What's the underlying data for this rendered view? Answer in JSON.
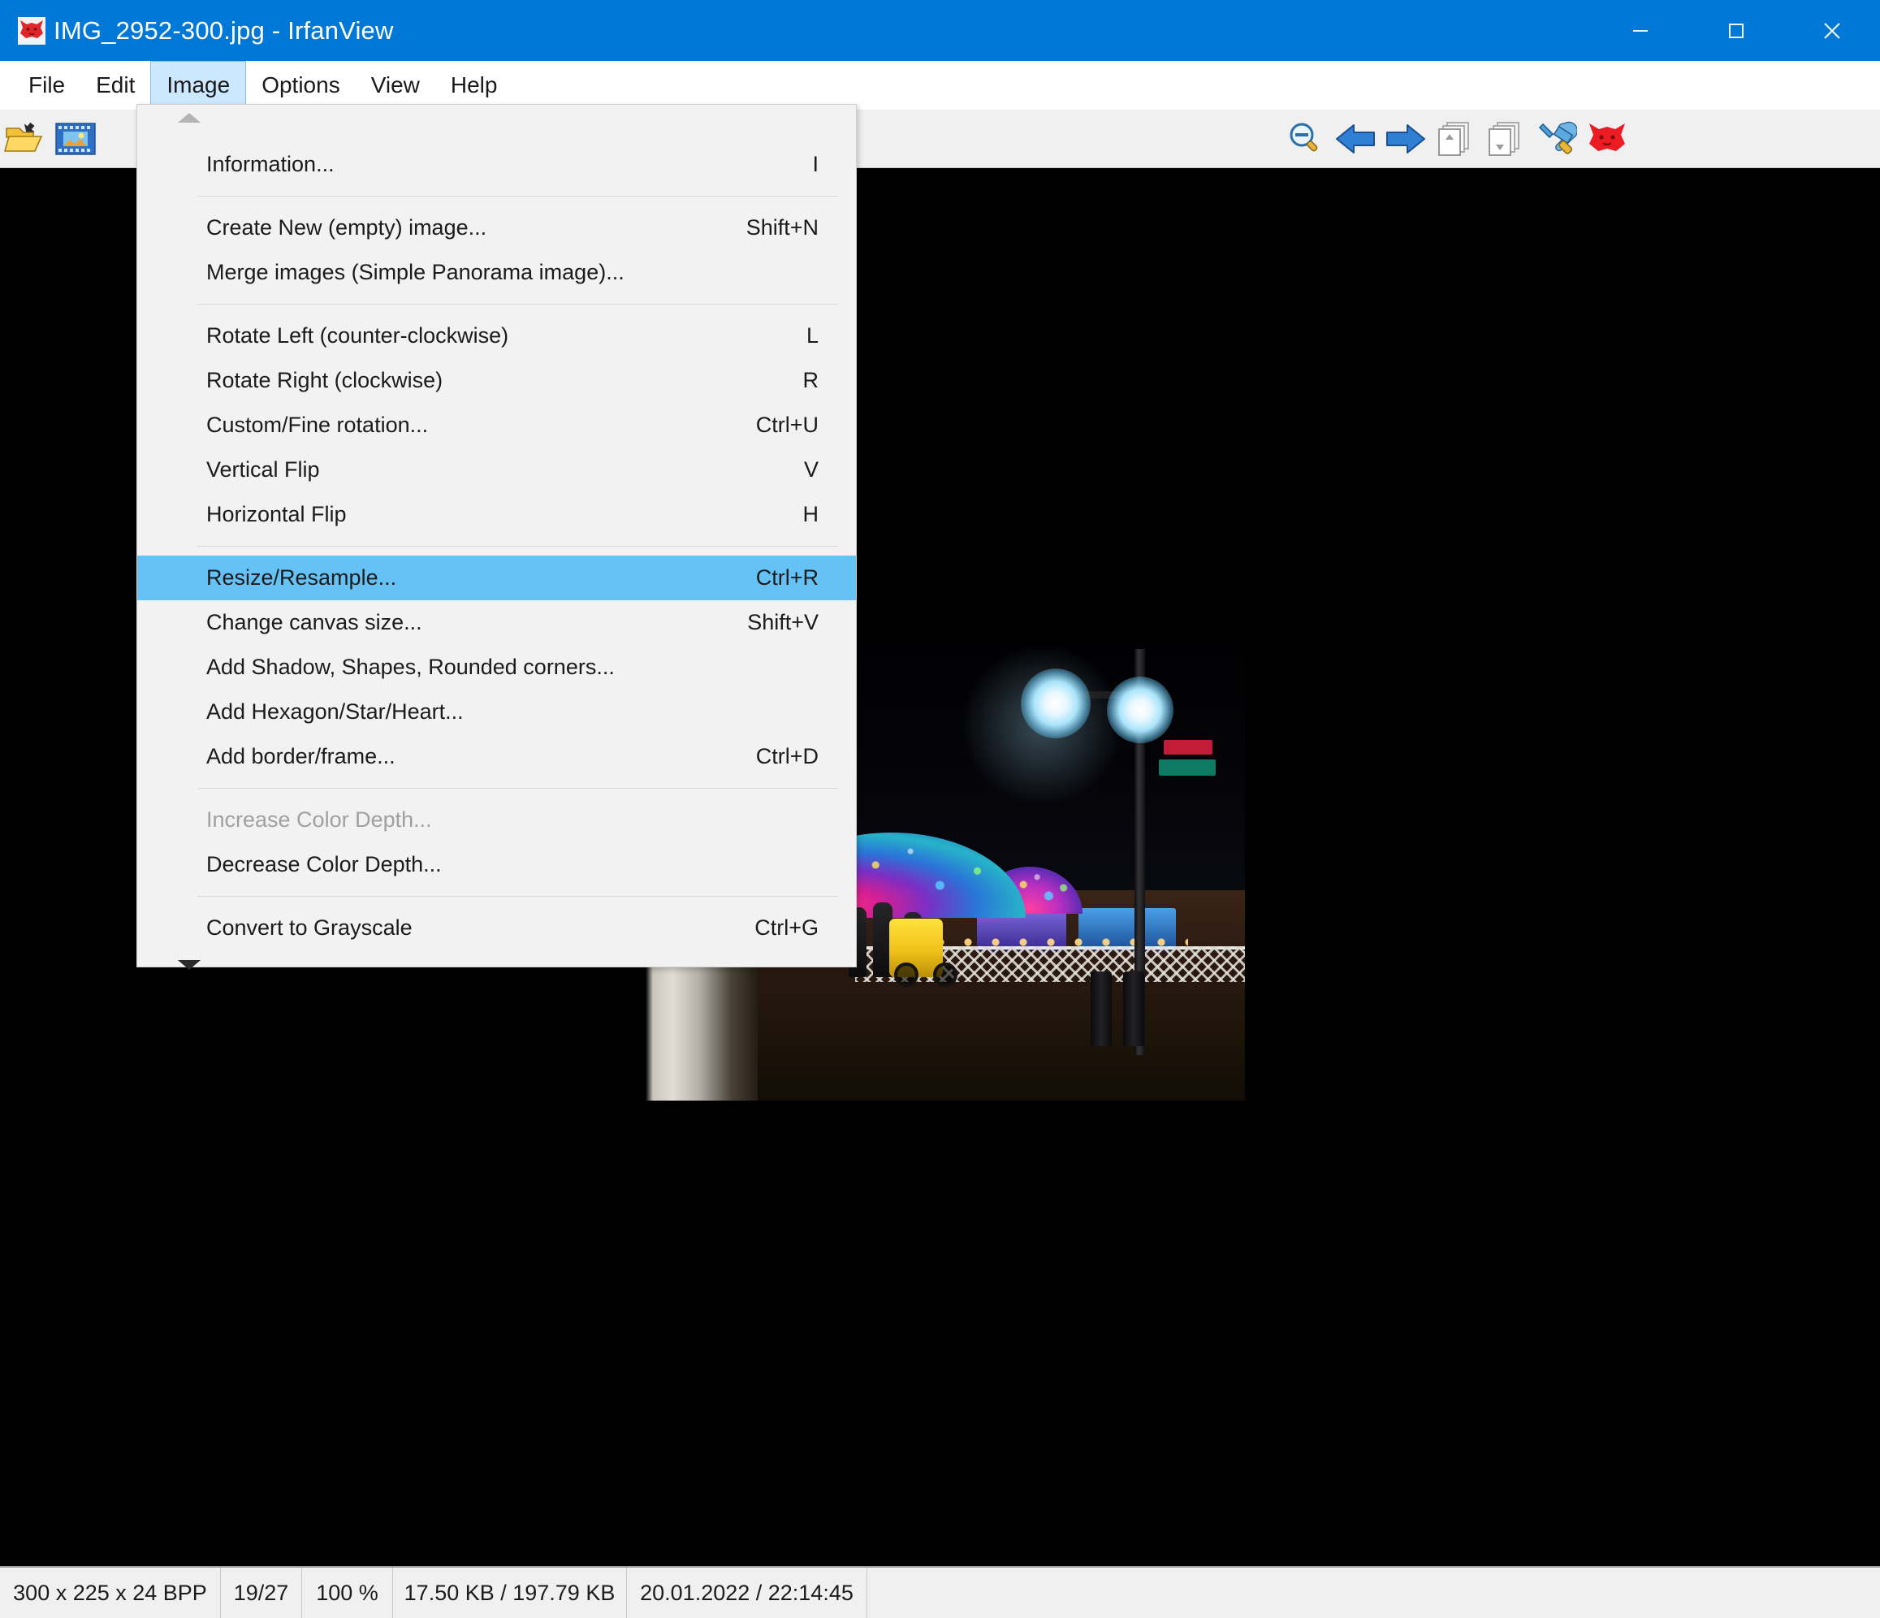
{
  "window": {
    "title": "IMG_2952-300.jpg - IrfanView",
    "app_icon": "irfanview-cat-icon",
    "controls": {
      "minimize": "minimize-icon",
      "maximize": "maximize-icon",
      "close": "close-icon"
    },
    "accent_color": "#0078d7"
  },
  "menubar": {
    "items": [
      {
        "label": "File",
        "active": false
      },
      {
        "label": "Edit",
        "active": false
      },
      {
        "label": "Image",
        "active": true
      },
      {
        "label": "Options",
        "active": false
      },
      {
        "label": "View",
        "active": false
      },
      {
        "label": "Help",
        "active": false
      }
    ]
  },
  "toolbar": {
    "buttons": [
      {
        "icon": "open-folder-icon",
        "enabled": true
      },
      {
        "icon": "thumbnails-icon",
        "enabled": true
      },
      {
        "icon": "zoom-out-icon",
        "enabled": true
      },
      {
        "icon": "previous-arrow-icon",
        "enabled": true
      },
      {
        "icon": "next-arrow-icon",
        "enabled": true
      },
      {
        "icon": "batch-up-icon",
        "enabled": false
      },
      {
        "icon": "batch-down-icon",
        "enabled": false
      },
      {
        "icon": "tools-settings-icon",
        "enabled": true
      },
      {
        "icon": "irfanview-cat-icon",
        "enabled": true
      }
    ]
  },
  "image_menu": {
    "scroll_up_icon": "scroll-up-arrow-icon",
    "scroll_down_icon": "scroll-down-arrow-icon",
    "highlight_color": "#66c2f5",
    "items": [
      {
        "label": "Information...",
        "accel": "I",
        "selected": false,
        "disabled": false,
        "sep_after": true
      },
      {
        "label": "Create New (empty) image...",
        "accel": "Shift+N",
        "selected": false,
        "disabled": false,
        "sep_after": false
      },
      {
        "label": "Merge images (Simple Panorama image)...",
        "accel": "",
        "selected": false,
        "disabled": false,
        "sep_after": true
      },
      {
        "label": "Rotate Left (counter-clockwise)",
        "accel": "L",
        "selected": false,
        "disabled": false,
        "sep_after": false
      },
      {
        "label": "Rotate Right (clockwise)",
        "accel": "R",
        "selected": false,
        "disabled": false,
        "sep_after": false
      },
      {
        "label": "Custom/Fine rotation...",
        "accel": "Ctrl+U",
        "selected": false,
        "disabled": false,
        "sep_after": false
      },
      {
        "label": "Vertical Flip",
        "accel": "V",
        "selected": false,
        "disabled": false,
        "sep_after": false
      },
      {
        "label": "Horizontal Flip",
        "accel": "H",
        "selected": false,
        "disabled": false,
        "sep_after": true
      },
      {
        "label": "Resize/Resample...",
        "accel": "Ctrl+R",
        "selected": true,
        "disabled": false,
        "sep_after": false
      },
      {
        "label": "Change canvas size...",
        "accel": "Shift+V",
        "selected": false,
        "disabled": false,
        "sep_after": false
      },
      {
        "label": "Add Shadow, Shapes, Rounded corners...",
        "accel": "",
        "selected": false,
        "disabled": false,
        "sep_after": false
      },
      {
        "label": "Add Hexagon/Star/Heart...",
        "accel": "",
        "selected": false,
        "disabled": false,
        "sep_after": false
      },
      {
        "label": "Add border/frame...",
        "accel": "Ctrl+D",
        "selected": false,
        "disabled": false,
        "sep_after": true
      },
      {
        "label": "Increase Color Depth...",
        "accel": "",
        "selected": false,
        "disabled": true,
        "sep_after": false
      },
      {
        "label": "Decrease Color Depth...",
        "accel": "",
        "selected": false,
        "disabled": false,
        "sep_after": true
      },
      {
        "label": "Convert to Grayscale",
        "accel": "Ctrl+G",
        "selected": false,
        "disabled": false,
        "sep_after": false
      }
    ]
  },
  "statusbar": {
    "dimensions": "300 x 225 x 24 BPP",
    "index": "19/27",
    "zoom": "100 %",
    "size": "17.50 KB / 197.79 KB",
    "datetime": "20.01.2022 / 22:14:45"
  },
  "canvas": {
    "background": "#000000",
    "image_alt": "night-street-scene-with-illuminated-domes"
  }
}
